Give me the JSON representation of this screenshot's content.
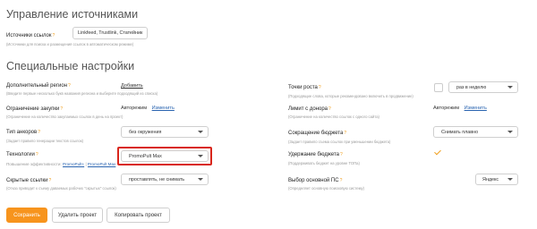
{
  "sources": {
    "title": "Управление источниками",
    "links_label": "Источники ссылок",
    "links_value": "Linkfeed, Trustlink, Статейник",
    "links_hint": "(Источники для поиска и размещения ссылок в автоматическом режиме)"
  },
  "special": {
    "title": "Специальные настройки",
    "region": {
      "label": "Дополнительный регион",
      "action": "Добавить",
      "hint": "(Введите первые несколько букв названия региона и выберите подходящий из списка)"
    },
    "growth_point": {
      "label": "Точки роста",
      "select_value": "раз в неделю",
      "hint": "(Подходящие слова, которые рекомендовано включить в продвижение)"
    },
    "purchase_limit": {
      "label": "Ограничение закупки",
      "value": "Авторежим",
      "action": "Изменить",
      "hint": "(Ограничение на количество закупаемых ссылок в день на проект)"
    },
    "donor_limit": {
      "label": "Лимит с донора",
      "value": "Авторежим",
      "action": "Изменить",
      "hint": "(Ограничение на количество ссылок с одного сайта)"
    },
    "anchor_type": {
      "label": "Тип анкоров",
      "select_value": "без окружения",
      "hint": "(Задает правило генерации текстов ссылок)"
    },
    "budget_cut": {
      "label": "Сокращение бюджета",
      "select_value": "Снимать плавно",
      "hint": "(Задает правило съема ссылок при уменьшении бюджета)"
    },
    "technologies": {
      "label": "Технологии",
      "select_value": "PromoPult Max",
      "hint_prefix": "Повышение эффективности:",
      "hint_link1": "PromoPult+",
      "hint_sep": " | ",
      "hint_link2": "PromoPult Max"
    },
    "budget_hold": {
      "label": "Удержание бюджета",
      "hint": "(Поддерживать бюджет на уровне ТОПа)"
    },
    "hidden_links": {
      "label": "Скрытые ссылки",
      "select_value": "проставлять, не снимать",
      "hint": "(Отказ приводит к съему даваемых рабочих \"скрытых\" ссылок)"
    },
    "main_ps": {
      "label": "Выбор основной ПС",
      "select_value": "Яндекс",
      "hint": "(Определяет основную поисковую систему)"
    }
  },
  "actions": {
    "save": "Сохранить",
    "delete": "Удалить проект",
    "copy": "Копировать проект"
  },
  "colors": {
    "accent": "#f7941d",
    "highlight": "#d9261c",
    "link": "#2a64b0"
  }
}
